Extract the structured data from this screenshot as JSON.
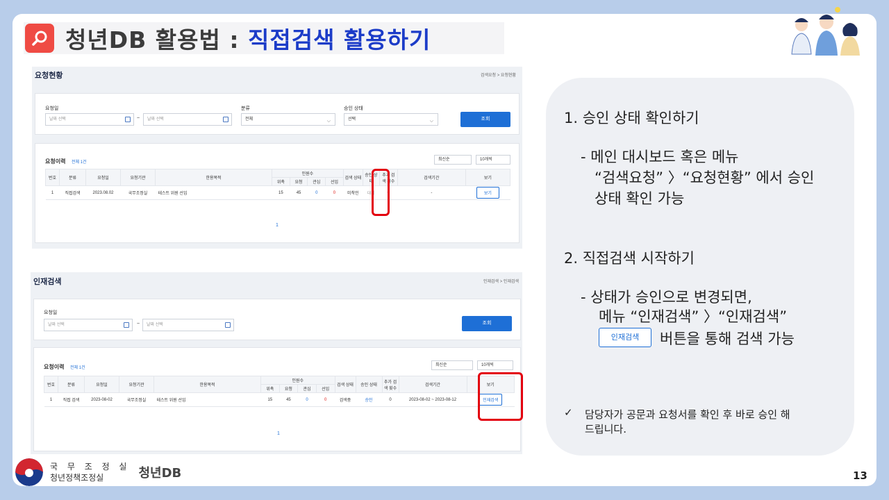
{
  "title": {
    "prefix": "청년DB 활용법 : ",
    "highlight": "직접검색 활용하기"
  },
  "page_number": "13",
  "footer": {
    "org_line1": "국 무 조 정 실",
    "org_line2": "청년정책조정실",
    "brand": "청년DB"
  },
  "screen1": {
    "title": "요청현황",
    "breadcrumb": "검색요청 > 요청현황",
    "filters": {
      "date_label": "요청일",
      "date_placeholder": "날짜 선택",
      "tilde": "~",
      "category_label": "분류",
      "category_value": "전체",
      "status_label": "승인 상태",
      "status_value": "선택",
      "search_button": "조회"
    },
    "list": {
      "title": "요청이력",
      "count": "전체 1건",
      "sort": "최신순",
      "per_page": "10개씩",
      "headers": [
        "번호",
        "분류",
        "요청일",
        "요청기관",
        "한용목적",
        "인원수",
        "위촉",
        "요청",
        "관심",
        "선임",
        "검색 상태",
        "승인 상태",
        "추가 검색 횟수",
        "검색기간",
        "보기"
      ],
      "row": {
        "no": "1",
        "category": "직접검색",
        "date": "2023.08.02",
        "org": "국무조정실",
        "purpose": "테스트 위원 선임",
        "n1": "15",
        "n2": "45",
        "n3": "0",
        "n4": "0",
        "search_status": "미착인",
        "approval": "대기",
        "extra": "0",
        "period": "-",
        "view": "보기"
      },
      "page": "1"
    }
  },
  "screen2": {
    "title": "인재검색",
    "breadcrumb": "인재검색 > 인재검색",
    "filters": {
      "date_label": "요청일",
      "date_placeholder": "날짜 선택",
      "tilde": "~",
      "search_button": "조회"
    },
    "list": {
      "title": "요청이력",
      "count": "전체 1건",
      "sort": "최신순",
      "per_page": "10개씩",
      "headers": [
        "번호",
        "분류",
        "요청일",
        "요청기관",
        "한용목적",
        "인원수",
        "위촉",
        "요청",
        "관심",
        "선임",
        "검색 상태",
        "승인 상태",
        "추가 검색 횟수",
        "검색기간",
        "보기"
      ],
      "row": {
        "no": "1",
        "category": "직접 검색",
        "date": "2023-08-02",
        "org": "국무조정실",
        "purpose": "테스트 위원 선임",
        "n1": "15",
        "n2": "45",
        "n3": "0",
        "n4": "0",
        "search_status": "검색중",
        "approval": "승인",
        "extra": "0",
        "period": "2023-08-02 ~ 2023-08-12",
        "view": "인재검색"
      },
      "page": "1"
    }
  },
  "explanation": {
    "step1_title": "1.  승인 상태 확인하기",
    "step1_line1": "- 메인 대시보드 혹은 메뉴",
    "step1_line2": "“검색요청” 〉“요청현황” 에서 승인",
    "step1_line3": "상태 확인 가능",
    "step2_title": "2.  직접검색 시작하기",
    "step2_line1": "- 상태가 승인으로 변경되면,",
    "step2_line2": "메뉴 “인재검색” 〉“인재검색”",
    "step2_button": "인재검색",
    "step2_line3": "버튼을 통해 검색 가능",
    "note_mark": "✓",
    "note_line1": "담당자가 공문과 요청서를 확인 후 바로 승인 해",
    "note_line2": "드립니다."
  }
}
